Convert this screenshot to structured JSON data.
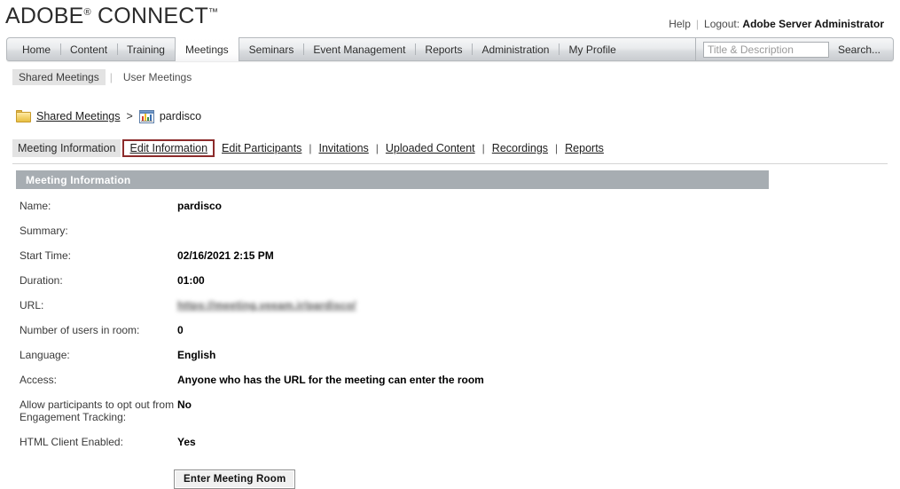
{
  "brand": {
    "name_part1": "ADOBE",
    "registered": "®",
    "name_part2": "CONNECT",
    "trademark": "™"
  },
  "user_bar": {
    "help": "Help",
    "logout_label": "Logout:",
    "username": "Adobe Server Administrator"
  },
  "main_nav": {
    "items": [
      {
        "label": "Home",
        "active": false
      },
      {
        "label": "Content",
        "active": false
      },
      {
        "label": "Training",
        "active": false
      },
      {
        "label": "Meetings",
        "active": true
      },
      {
        "label": "Seminars",
        "active": false
      },
      {
        "label": "Event Management",
        "active": false
      },
      {
        "label": "Reports",
        "active": false
      },
      {
        "label": "Administration",
        "active": false
      },
      {
        "label": "My Profile",
        "active": false
      }
    ],
    "search_placeholder": "Title & Description",
    "search_value": "",
    "search_label": "Search..."
  },
  "sub_nav": {
    "items": [
      {
        "label": "Shared Meetings",
        "selected": true
      },
      {
        "label": "User Meetings",
        "selected": false
      }
    ],
    "separator": "|"
  },
  "breadcrumb": {
    "folder_icon": "folder-icon",
    "root_label": "Shared Meetings",
    "arrow": ">",
    "meeting_icon": "meeting-room-icon",
    "current_label": "pardisco"
  },
  "tabstrip": {
    "items": [
      {
        "label": "Meeting Information",
        "state": "current"
      },
      {
        "label": "Edit Information",
        "state": "highlighted"
      },
      {
        "label": "Edit Participants",
        "state": "link"
      },
      {
        "label": "Invitations",
        "state": "link"
      },
      {
        "label": "Uploaded Content",
        "state": "link"
      },
      {
        "label": "Recordings",
        "state": "link"
      },
      {
        "label": "Reports",
        "state": "link"
      }
    ],
    "separator": "|",
    "highlight_color": "#8c2b2b"
  },
  "section": {
    "title": "Meeting Information",
    "header_bg": "#a7adb2"
  },
  "details": [
    {
      "label": "Name:",
      "value": "pardisco",
      "type": "text"
    },
    {
      "label": "Summary:",
      "value": "",
      "type": "text"
    },
    {
      "label": "Start Time:",
      "value": "02/16/2021 2:15 PM",
      "type": "text"
    },
    {
      "label": "Duration:",
      "value": "01:00",
      "type": "text"
    },
    {
      "label": "URL:",
      "value": "https://meeting.veeam.ir/pardisco/",
      "type": "url-blurred"
    },
    {
      "label": "Number of users in room:",
      "value": "0",
      "type": "text"
    },
    {
      "label": "Language:",
      "value": "English",
      "type": "text"
    },
    {
      "label": "Access:",
      "value": "Anyone who has the URL for the meeting can enter the room",
      "type": "text"
    },
    {
      "label": "Allow participants to opt out from Engagement Tracking:",
      "value": "No",
      "type": "text"
    },
    {
      "label": "HTML Client Enabled:",
      "value": "Yes",
      "type": "text"
    }
  ],
  "actions": {
    "enter_meeting_room": "Enter Meeting Room"
  }
}
